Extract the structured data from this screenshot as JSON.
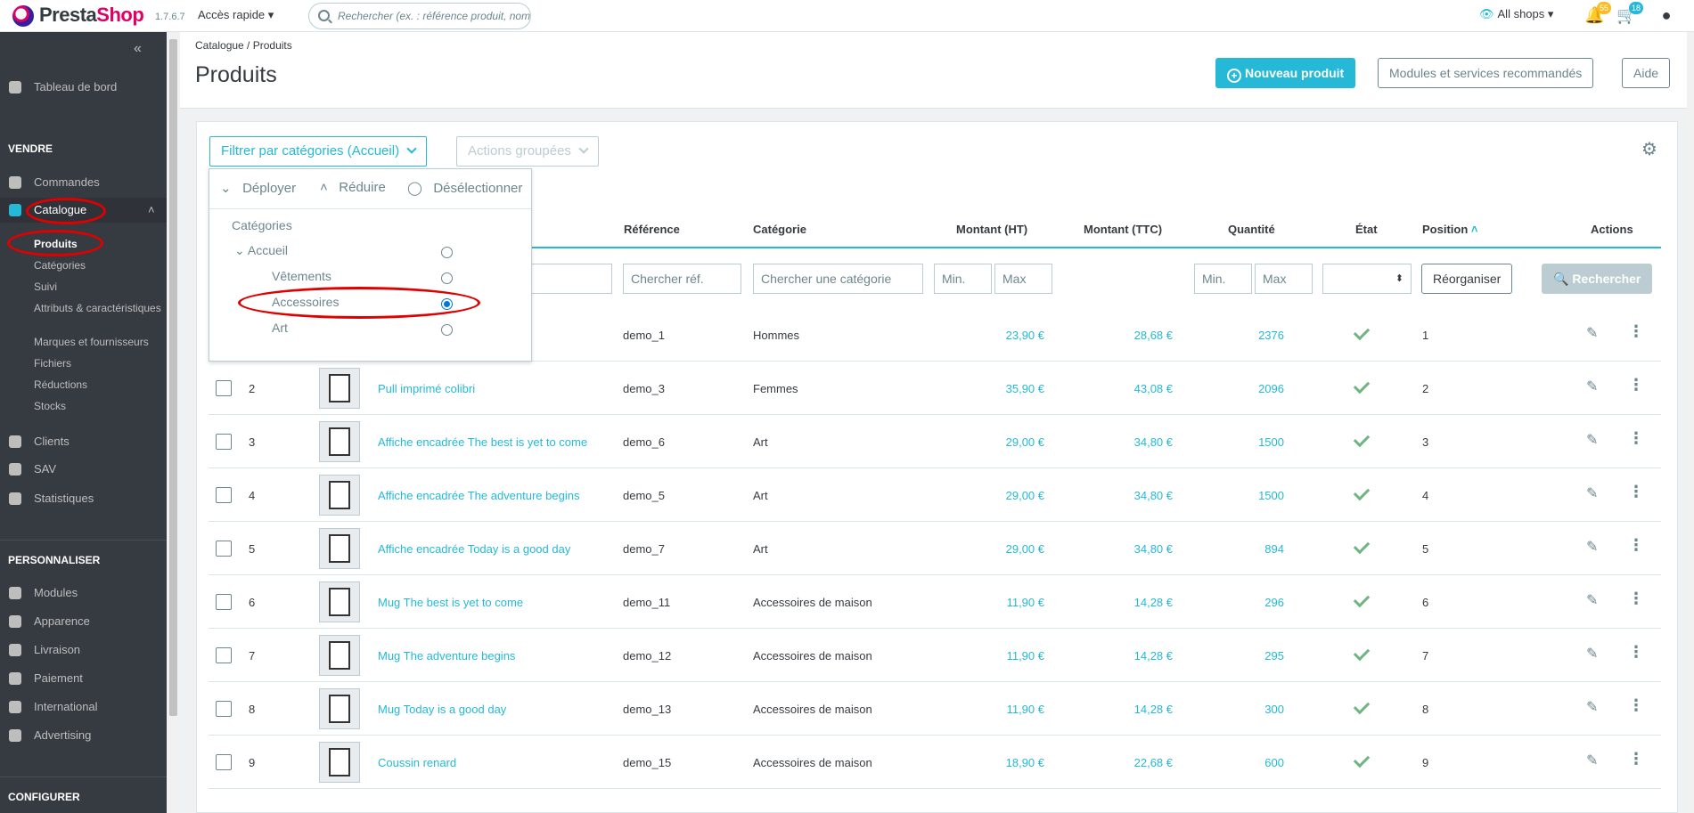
{
  "header": {
    "logo": "PrestaShop",
    "version": "1.7.6.7",
    "quick_access": "Accès rapide",
    "search_placeholder": "Rechercher (ex. : référence produit, nom",
    "all_shops": "All shops",
    "notif_orders": "55",
    "notif_customers": "18"
  },
  "sidebar": {
    "dashboard": "Tableau de bord",
    "section_sell": "VENDRE",
    "orders": "Commandes",
    "catalog": "Catalogue",
    "catalog_sub": [
      "Produits",
      "Catégories",
      "Suivi",
      "Attributs & caractéristiques",
      "Marques et fournisseurs",
      "Fichiers",
      "Réductions",
      "Stocks"
    ],
    "customers": "Clients",
    "sav": "SAV",
    "stats": "Statistiques",
    "section_custom": "PERSONNALISER",
    "modules": "Modules",
    "appearance": "Apparence",
    "shipping": "Livraison",
    "payment": "Paiement",
    "international": "International",
    "advertising": "Advertising",
    "section_config": "CONFIGURER"
  },
  "page": {
    "breadcrumb_parent": "Catalogue",
    "breadcrumb_current": "Produits",
    "title": "Produits",
    "new_product": "Nouveau produit",
    "modules_btn": "Modules et services recommandés",
    "help": "Aide"
  },
  "filters": {
    "category_filter": "Filtrer par catégories (Accueil)",
    "bulk_actions": "Actions groupées",
    "deploy": "Déployer",
    "reduce": "Réduire",
    "deselect": "Désélectionner",
    "categories_label": "Catégories",
    "tree": [
      "Accueil",
      "Vêtements",
      "Accessoires",
      "Art"
    ],
    "selected": "Accessoires"
  },
  "table": {
    "headers": {
      "reference": "Référence",
      "category": "Catégorie",
      "price_ht": "Montant (HT)",
      "price_ttc": "Montant (TTC)",
      "quantity": "Quantité",
      "state": "État",
      "position": "Position",
      "actions": "Actions"
    },
    "filters": {
      "ref": "Chercher réf.",
      "category": "Chercher une catégorie",
      "min": "Min.",
      "max": "Max",
      "reorganize": "Réorganiser",
      "search": "Rechercher"
    },
    "rows": [
      {
        "id": "",
        "name": "",
        "ref": "demo_1",
        "category": "Hommes",
        "ht": "23,90 €",
        "ttc": "28,68 €",
        "qty": "2376",
        "pos": "1"
      },
      {
        "id": "2",
        "name": "Pull imprimé colibri",
        "ref": "demo_3",
        "category": "Femmes",
        "ht": "35,90 €",
        "ttc": "43,08 €",
        "qty": "2096",
        "pos": "2"
      },
      {
        "id": "3",
        "name": "Affiche encadrée The best is yet to come",
        "ref": "demo_6",
        "category": "Art",
        "ht": "29,00 €",
        "ttc": "34,80 €",
        "qty": "1500",
        "pos": "3"
      },
      {
        "id": "4",
        "name": "Affiche encadrée The adventure begins",
        "ref": "demo_5",
        "category": "Art",
        "ht": "29,00 €",
        "ttc": "34,80 €",
        "qty": "1500",
        "pos": "4"
      },
      {
        "id": "5",
        "name": "Affiche encadrée Today is a good day",
        "ref": "demo_7",
        "category": "Art",
        "ht": "29,00 €",
        "ttc": "34,80 €",
        "qty": "894",
        "pos": "5"
      },
      {
        "id": "6",
        "name": "Mug The best is yet to come",
        "ref": "demo_11",
        "category": "Accessoires de maison",
        "ht": "11,90 €",
        "ttc": "14,28 €",
        "qty": "296",
        "pos": "6"
      },
      {
        "id": "7",
        "name": "Mug The adventure begins",
        "ref": "demo_12",
        "category": "Accessoires de maison",
        "ht": "11,90 €",
        "ttc": "14,28 €",
        "qty": "295",
        "pos": "7"
      },
      {
        "id": "8",
        "name": "Mug Today is a good day",
        "ref": "demo_13",
        "category": "Accessoires de maison",
        "ht": "11,90 €",
        "ttc": "14,28 €",
        "qty": "300",
        "pos": "8"
      },
      {
        "id": "9",
        "name": "Coussin renard",
        "ref": "demo_15",
        "category": "Accessoires de maison",
        "ht": "18,90 €",
        "ttc": "22,68 €",
        "qty": "600",
        "pos": "9"
      }
    ]
  }
}
